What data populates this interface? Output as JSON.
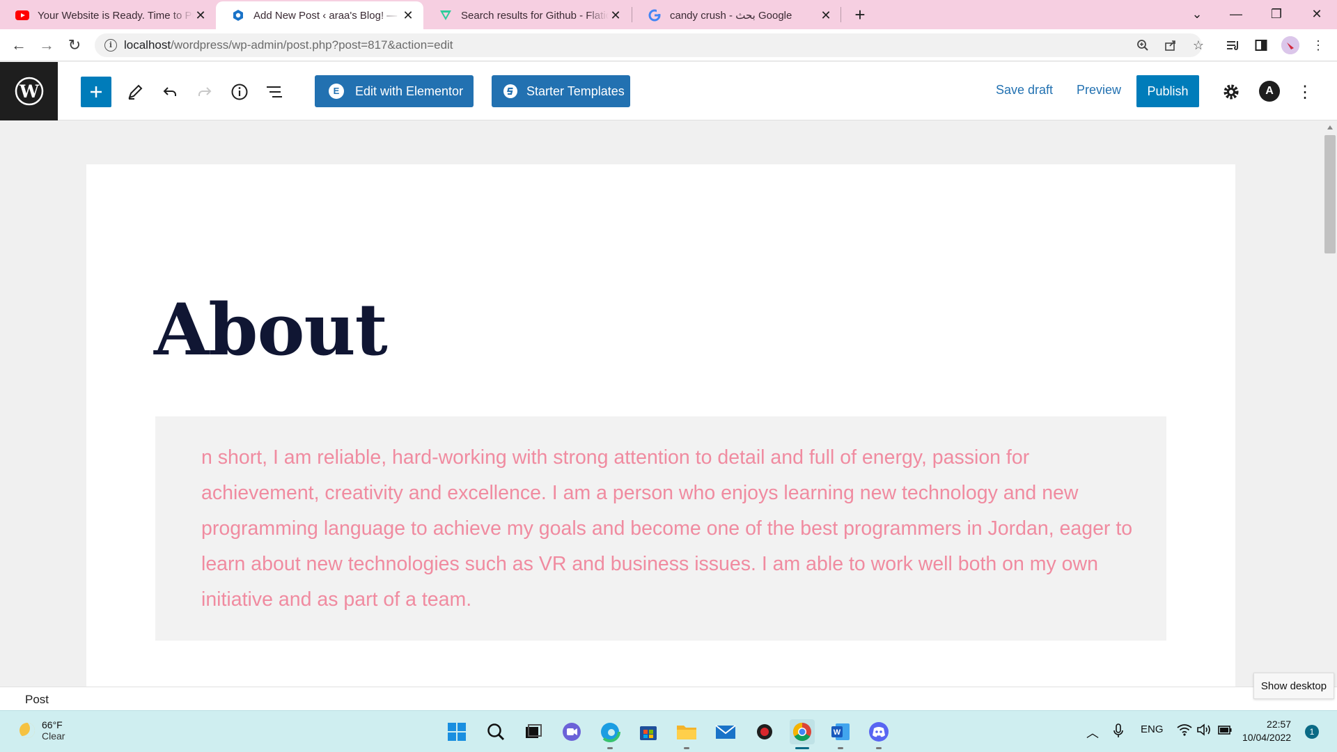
{
  "browser": {
    "tabs": [
      {
        "title": "Your Website is Ready. Time to Pu",
        "favicon": "youtube-icon",
        "active": false
      },
      {
        "title": "Add New Post ‹ araa's Blog! — W",
        "favicon": "wordpress-hex-icon",
        "active": true
      },
      {
        "title": "Search results for Github - Flaticon",
        "favicon": "flaticon-icon",
        "active": false
      },
      {
        "title": "candy crush - بحث Google",
        "favicon": "google-icon",
        "active": false
      }
    ],
    "url_host": "localhost",
    "url_path": "/wordpress/wp-admin/post.php?post=817&action=edit"
  },
  "editor": {
    "elementor_label": "Edit with Elementor",
    "starter_label": "Starter Templates",
    "save_draft_label": "Save draft",
    "preview_label": "Preview",
    "publish_label": "Publish",
    "accent": "#007cba",
    "astra_letter": "A"
  },
  "post": {
    "title": "About",
    "quote": "n short, I am reliable, hard-working with strong attention to detail and full of energy, passion for achievement, creativity and excellence. I am a person who enjoys learning new technology and new programming language to achieve my goals and become one of the best programmers in Jordan, eager to learn about new technologies such as VR and business issues. I am able to work well both on my own initiative and as part of a team.",
    "quote_color": "#f08ba0"
  },
  "footer": {
    "breadcrumb": "Post"
  },
  "tooltip": {
    "show_desktop": "Show desktop"
  },
  "taskbar": {
    "weather_temp": "66°F",
    "weather_cond": "Clear",
    "language": "ENG",
    "time": "22:57",
    "date": "10/04/2022",
    "notification_count": "1"
  }
}
